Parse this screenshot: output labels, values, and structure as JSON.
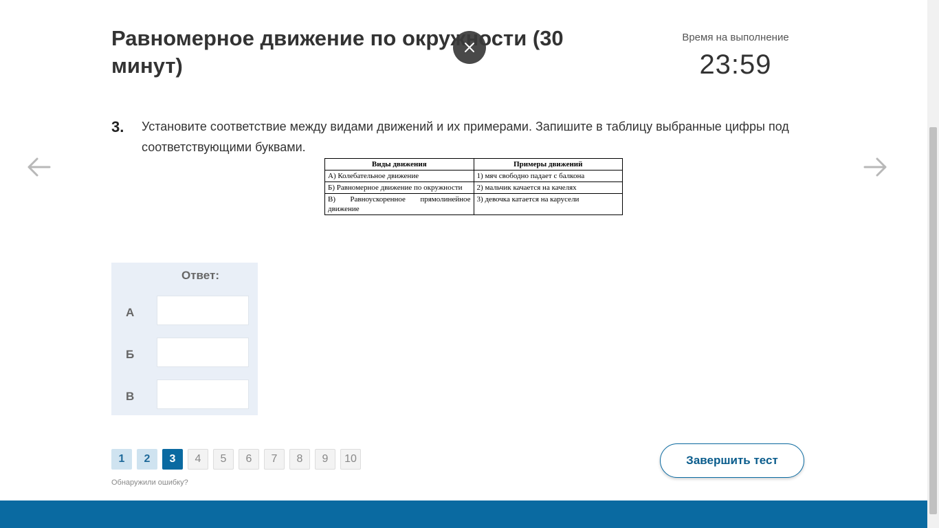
{
  "header": {
    "title": "Равномерное движение по окружности (30 минут)",
    "timer_label": "Время на выполнение",
    "timer_value": "23:59"
  },
  "question": {
    "number": "3.",
    "text": "Установите соответствие между видами движений и их примерами. Запишите в таблицу выбранные цифры под соответствующими буквами."
  },
  "match_table": {
    "headers": [
      "Виды движения",
      "Примеры движений"
    ],
    "rows": [
      [
        "А) Колебательное движение",
        "1) мяч свободно падает с балкона"
      ],
      [
        "Б) Равномерное движение по окружности",
        "2) мальчик качается на качелях"
      ],
      [
        "В) Равноускоренное прямолинейное движение",
        "3) девочка катается на карусели"
      ]
    ]
  },
  "answer": {
    "title": "Ответ:",
    "rows": [
      {
        "label": "А",
        "value": ""
      },
      {
        "label": "Б",
        "value": ""
      },
      {
        "label": "В",
        "value": ""
      }
    ]
  },
  "pagination": {
    "pages": [
      {
        "label": "1",
        "state": "done"
      },
      {
        "label": "2",
        "state": "done"
      },
      {
        "label": "3",
        "state": "current"
      },
      {
        "label": "4",
        "state": "todo"
      },
      {
        "label": "5",
        "state": "todo"
      },
      {
        "label": "6",
        "state": "todo"
      },
      {
        "label": "7",
        "state": "todo"
      },
      {
        "label": "8",
        "state": "todo"
      },
      {
        "label": "9",
        "state": "todo"
      },
      {
        "label": "10",
        "state": "todo"
      }
    ]
  },
  "report_link": "Обнаружили ошибку?",
  "finish_button": "Завершить тест",
  "icons": {
    "close": "close-icon",
    "prev": "arrow-left-icon",
    "next": "arrow-right-icon"
  },
  "colors": {
    "accent": "#0a6aa1",
    "page_done_bg": "#cfe3f0",
    "answer_bg": "#e9eff7"
  }
}
